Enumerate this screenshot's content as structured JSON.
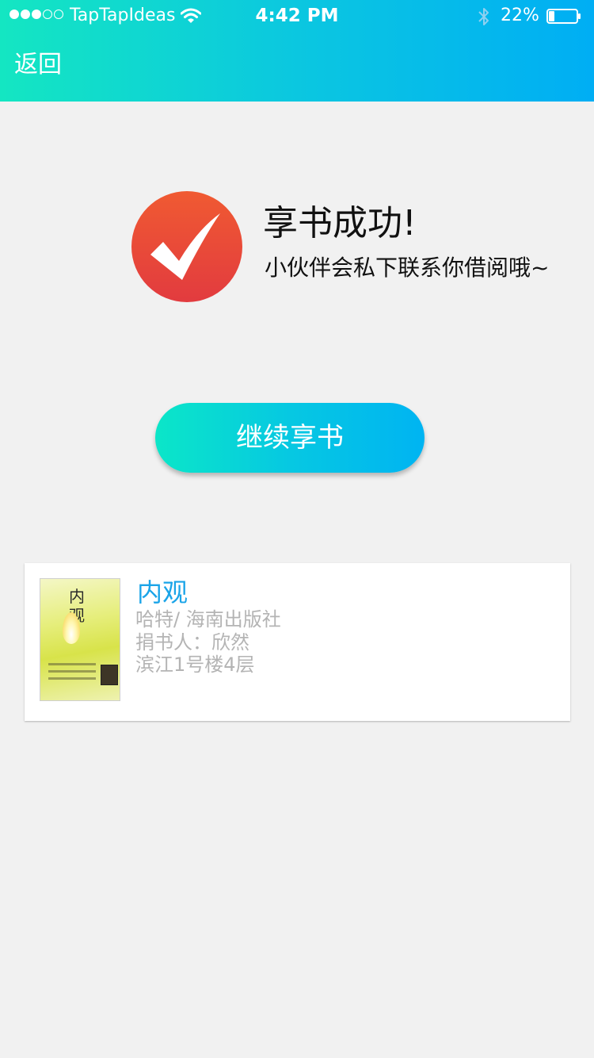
{
  "status_bar": {
    "carrier": "TapTapIdeas",
    "time": "4:42 PM",
    "battery_percent": "22%",
    "signal_bars_filled": 3,
    "signal_bars_total": 5,
    "battery_level": 0.22
  },
  "nav": {
    "back_label": "返回"
  },
  "success": {
    "title": "享书成功!",
    "subtitle": "小伙伴会私下联系你借阅哦~"
  },
  "actions": {
    "continue_label": "继续享书"
  },
  "book": {
    "title": "内观",
    "author_publisher": "哈特/  海南出版社",
    "donor": "捐书人：欣然",
    "location": "滨江1号楼4层",
    "cover_title": "内观"
  },
  "colors": {
    "header_gradient_start": "#14e6c2",
    "header_gradient_end": "#00aef4",
    "success_icon": "#e84a3a",
    "book_title": "#1aa4e8",
    "meta_text": "#b4b4b4"
  }
}
